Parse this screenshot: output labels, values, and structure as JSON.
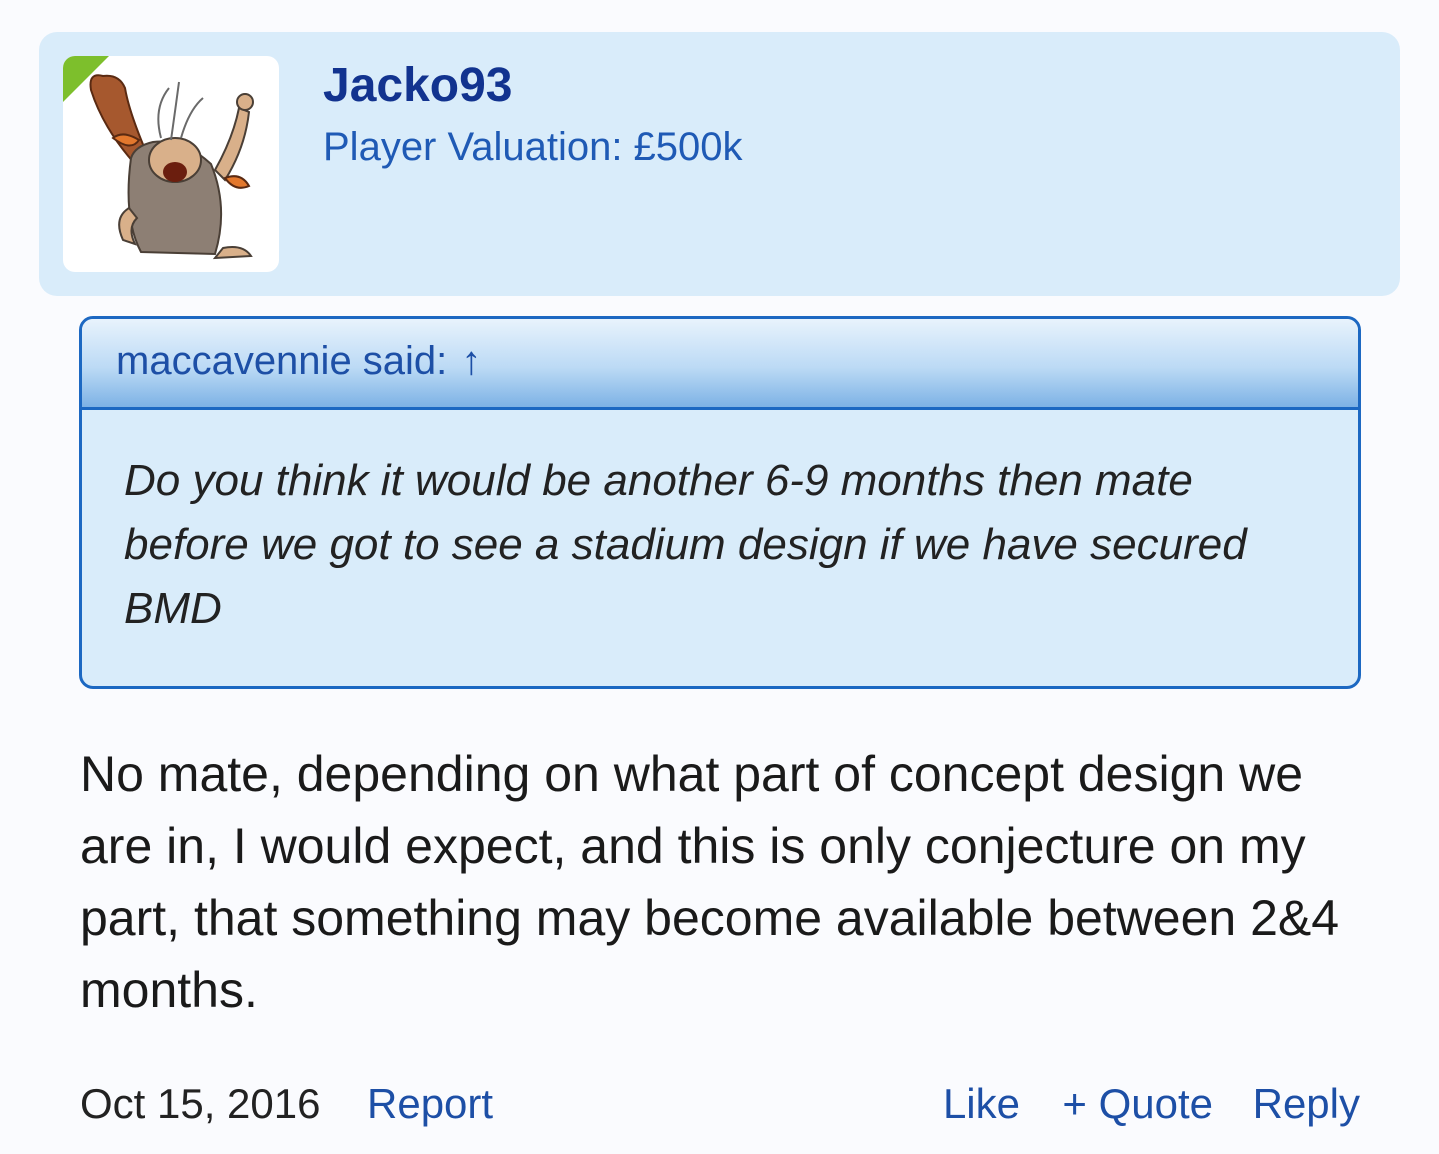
{
  "user": {
    "username": "Jacko93",
    "title": "Player Valuation: £500k"
  },
  "quote": {
    "author_label": "maccavennie said:",
    "arrow": "↑",
    "text": "Do you think it would be another 6-9 months then mate before we got to see a stadium design if we have secured BMD"
  },
  "message": {
    "text": "No mate, depending on what part of concept design we are in, I would expect, and this is only conjecture on my part, that something may become available between 2&4 months."
  },
  "footer": {
    "date": "Oct 15, 2016",
    "report": "Report",
    "like": "Like",
    "quote": "+ Quote",
    "reply": "Reply"
  },
  "colors": {
    "header_bg": "#d9ecfa",
    "username": "#12338f",
    "link": "#1d4fa6",
    "quote_border": "#1c68c2",
    "online": "#7dbf2c"
  }
}
